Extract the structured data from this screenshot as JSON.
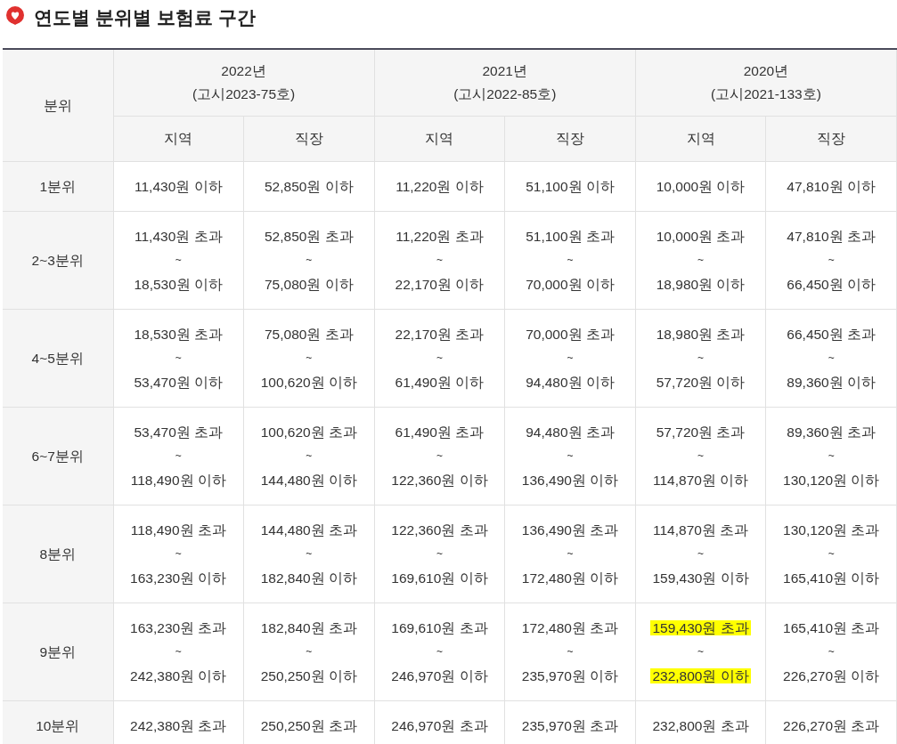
{
  "title": "연도별 분위별 보험료 구간",
  "table": {
    "corner": "분위",
    "years": [
      {
        "year": "2022년",
        "notice": "(고시2023-75호)",
        "subcolumns": [
          "지역",
          "직장"
        ]
      },
      {
        "year": "2021년",
        "notice": "(고시2022-85호)",
        "subcolumns": [
          "지역",
          "직장"
        ]
      },
      {
        "year": "2020년",
        "notice": "(고시2021-133호)",
        "subcolumns": [
          "지역",
          "직장"
        ]
      }
    ],
    "rows": [
      {
        "label": "1분위",
        "cells": [
          {
            "lines": [
              "11,430원 이하"
            ],
            "highlighted": false
          },
          {
            "lines": [
              "52,850원 이하"
            ],
            "highlighted": false
          },
          {
            "lines": [
              "11,220원 이하"
            ],
            "highlighted": false
          },
          {
            "lines": [
              "51,100원 이하"
            ],
            "highlighted": false
          },
          {
            "lines": [
              "10,000원 이하"
            ],
            "highlighted": false
          },
          {
            "lines": [
              "47,810원 이하"
            ],
            "highlighted": false
          }
        ]
      },
      {
        "label": "2~3분위",
        "cells": [
          {
            "lines": [
              "11,430원 초과",
              "~",
              "18,530원 이하"
            ],
            "highlighted": false
          },
          {
            "lines": [
              "52,850원 초과",
              "~",
              "75,080원 이하"
            ],
            "highlighted": false
          },
          {
            "lines": [
              "11,220원 초과",
              "~",
              "22,170원 이하"
            ],
            "highlighted": false
          },
          {
            "lines": [
              "51,100원 초과",
              "~",
              "70,000원 이하"
            ],
            "highlighted": false
          },
          {
            "lines": [
              "10,000원 초과",
              "~",
              "18,980원 이하"
            ],
            "highlighted": false
          },
          {
            "lines": [
              "47,810원 초과",
              "~",
              "66,450원 이하"
            ],
            "highlighted": false
          }
        ]
      },
      {
        "label": "4~5분위",
        "cells": [
          {
            "lines": [
              "18,530원 초과",
              "~",
              "53,470원 이하"
            ],
            "highlighted": false
          },
          {
            "lines": [
              "75,080원 초과",
              "~",
              "100,620원 이하"
            ],
            "highlighted": false
          },
          {
            "lines": [
              "22,170원 초과",
              "~",
              "61,490원 이하"
            ],
            "highlighted": false
          },
          {
            "lines": [
              "70,000원 초과",
              "~",
              "94,480원 이하"
            ],
            "highlighted": false
          },
          {
            "lines": [
              "18,980원 초과",
              "~",
              "57,720원 이하"
            ],
            "highlighted": false
          },
          {
            "lines": [
              "66,450원 초과",
              "~",
              "89,360원 이하"
            ],
            "highlighted": false
          }
        ]
      },
      {
        "label": "6~7분위",
        "cells": [
          {
            "lines": [
              "53,470원 초과",
              "~",
              "118,490원 이하"
            ],
            "highlighted": false
          },
          {
            "lines": [
              "100,620원 초과",
              "~",
              "144,480원 이하"
            ],
            "highlighted": false
          },
          {
            "lines": [
              "61,490원 초과",
              "~",
              "122,360원 이하"
            ],
            "highlighted": false
          },
          {
            "lines": [
              "94,480원 초과",
              "~",
              "136,490원 이하"
            ],
            "highlighted": false
          },
          {
            "lines": [
              "57,720원 초과",
              "~",
              "114,870원 이하"
            ],
            "highlighted": false
          },
          {
            "lines": [
              "89,360원 초과",
              "~",
              "130,120원 이하"
            ],
            "highlighted": false
          }
        ]
      },
      {
        "label": "8분위",
        "cells": [
          {
            "lines": [
              "118,490원 초과",
              "~",
              "163,230원 이하"
            ],
            "highlighted": false
          },
          {
            "lines": [
              "144,480원 초과",
              "~",
              "182,840원 이하"
            ],
            "highlighted": false
          },
          {
            "lines": [
              "122,360원 초과",
              "~",
              "169,610원 이하"
            ],
            "highlighted": false
          },
          {
            "lines": [
              "136,490원 초과",
              "~",
              "172,480원 이하"
            ],
            "highlighted": false
          },
          {
            "lines": [
              "114,870원 초과",
              "~",
              "159,430원 이하"
            ],
            "highlighted": false
          },
          {
            "lines": [
              "130,120원 초과",
              "~",
              "165,410원 이하"
            ],
            "highlighted": false
          }
        ]
      },
      {
        "label": "9분위",
        "cells": [
          {
            "lines": [
              "163,230원 초과",
              "~",
              "242,380원 이하"
            ],
            "highlighted": false
          },
          {
            "lines": [
              "182,840원 초과",
              "~",
              "250,250원 이하"
            ],
            "highlighted": false
          },
          {
            "lines": [
              "169,610원 초과",
              "~",
              "246,970원 이하"
            ],
            "highlighted": false
          },
          {
            "lines": [
              "172,480원 초과",
              "~",
              "235,970원 이하"
            ],
            "highlighted": false
          },
          {
            "lines": [
              "159,430원 초과",
              "~",
              "232,800원 이하"
            ],
            "highlighted": true
          },
          {
            "lines": [
              "165,410원 초과",
              "~",
              "226,270원 이하"
            ],
            "highlighted": false
          }
        ]
      },
      {
        "label": "10분위",
        "cells": [
          {
            "lines": [
              "242,380원 초과"
            ],
            "highlighted": false
          },
          {
            "lines": [
              "250,250원 초과"
            ],
            "highlighted": false
          },
          {
            "lines": [
              "246,970원 초과"
            ],
            "highlighted": false
          },
          {
            "lines": [
              "235,970원 초과"
            ],
            "highlighted": false
          },
          {
            "lines": [
              "232,800원 초과"
            ],
            "highlighted": false
          },
          {
            "lines": [
              "226,270원 초과"
            ],
            "highlighted": false
          }
        ]
      }
    ]
  }
}
